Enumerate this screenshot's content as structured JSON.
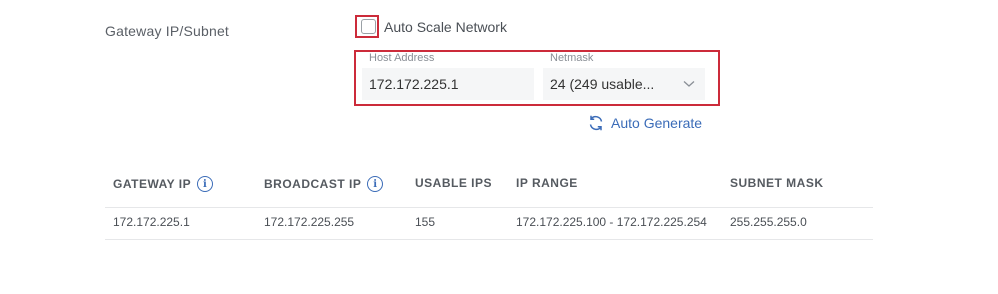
{
  "section_label": "Gateway IP/Subnet",
  "auto_scale": {
    "label": "Auto Scale Network",
    "checked": false
  },
  "host_address": {
    "caption": "Host Address",
    "value": "172.172.225.1"
  },
  "netmask": {
    "caption": "Netmask",
    "selected": "24 (249 usable..."
  },
  "auto_generate": {
    "label": "Auto Generate",
    "icon": "refresh-icon"
  },
  "colors": {
    "highlight": "#cc2b3a",
    "accent": "#3b6cb8"
  },
  "table": {
    "headers": {
      "gateway_ip": "GATEWAY IP",
      "broadcast_ip": "BROADCAST IP",
      "usable_ips": "USABLE IPS",
      "ip_range": "IP RANGE",
      "subnet_mask": "SUBNET MASK"
    },
    "info_glyph": "i",
    "rows": [
      {
        "gateway_ip": "172.172.225.1",
        "broadcast_ip": "172.172.225.255",
        "usable_ips": "155",
        "ip_range": "172.172.225.100 - 172.172.225.254",
        "subnet_mask": "255.255.255.0"
      }
    ]
  }
}
